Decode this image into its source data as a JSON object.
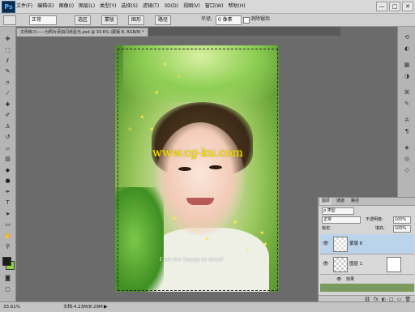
{
  "app": {
    "logo": "Ps",
    "menu": [
      "文件(F)",
      "编辑(E)",
      "图像(I)",
      "图层(L)",
      "类型(Y)",
      "选择(S)",
      "滤镜(T)",
      "3D(D)",
      "视图(V)",
      "窗口(W)",
      "帮助(H)"
    ]
  },
  "window": {
    "minimize": "—",
    "maximize": "□",
    "close": "✕"
  },
  "options": {
    "style_value": "正常",
    "btn_a": "选区",
    "btn_b": "蒙版",
    "btn_c": "图形",
    "btn_d": "路径",
    "label_diameter": "半径:",
    "diameter_value": "0 像素",
    "check_label": "消除锯齿"
  },
  "document": {
    "tab_title": "文例练习——为照片添加闪烁星光.psd @ 33.6% (蒙版 8, RGB/8) *"
  },
  "image": {
    "watermark": "www.cg-ku.com",
    "caption": "I am too happy to stand"
  },
  "layers_panel": {
    "tabs": [
      "图层",
      "通道",
      "路径"
    ],
    "kind_label": "ρ 类型",
    "blend_mode": "正常",
    "opacity_label": "不透明度:",
    "opacity_value": "100%",
    "lock_label": "锁定:",
    "fill_label": "填充:",
    "fill_value": "100%",
    "layers": [
      {
        "name": "蒙版 8",
        "selected": true
      },
      {
        "name": "图层 1",
        "selected": false
      }
    ],
    "effects_label": "效果",
    "bottom_icons": [
      "⛓",
      "fx",
      "◐",
      "□",
      "▭",
      "🗑"
    ]
  },
  "status": {
    "zoom": "33.61%",
    "doc": "文档:4.23M/8.29M",
    "arrow": "▶"
  },
  "colors": {
    "accent_selection": "#bcd3ec",
    "foreground": "#1d1d1d",
    "background": "#8fd43f"
  },
  "icons": {
    "tools": [
      "move-icon",
      "marquee-icon",
      "lasso-icon",
      "quick-select-icon",
      "crop-icon",
      "eyedropper-icon",
      "healing-icon",
      "brush-icon",
      "stamp-icon",
      "history-brush-icon",
      "eraser-icon",
      "gradient-icon",
      "blur-icon",
      "dodge-icon",
      "pen-icon",
      "type-icon",
      "path-select-icon",
      "shape-icon",
      "hand-icon",
      "zoom-icon"
    ],
    "right": [
      "history-icon",
      "color-icon",
      "swatches-icon",
      "adjust-icon",
      "styles-icon",
      "brush-panel-icon",
      "character-icon",
      "paragraph-icon",
      "layers-icon",
      "channels-icon",
      "paths-icon"
    ]
  }
}
